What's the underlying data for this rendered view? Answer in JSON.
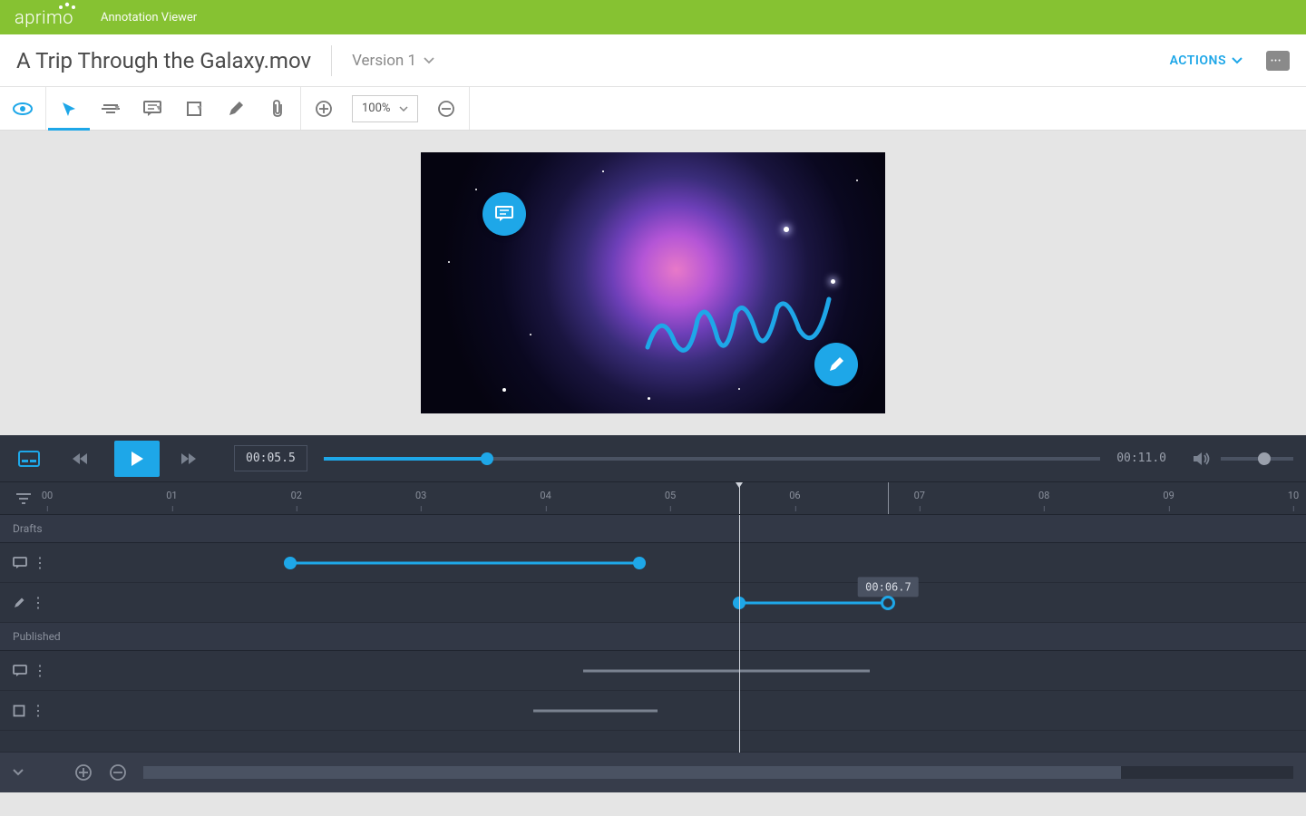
{
  "header": {
    "brand": "aprimo",
    "app_title": "Annotation Viewer"
  },
  "file": {
    "name": "A Trip Through the Galaxy.mov",
    "version_label": "Version 1",
    "actions_label": "ACTIONS"
  },
  "toolbar": {
    "zoom_level": "100%"
  },
  "player": {
    "current_time": "00:05.5",
    "duration": "00:11.0",
    "progress_pct": 21,
    "volume_pct": 60
  },
  "ruler": {
    "ticks": [
      "00",
      "01",
      "02",
      "03",
      "04",
      "05",
      "06",
      "07",
      "08",
      "09",
      "10"
    ],
    "playhead_pct": 55.5,
    "range_end_pct": 67.5
  },
  "sections": {
    "drafts": "Drafts",
    "published": "Published"
  },
  "tooltip_time": "00:06.7",
  "tracks": {
    "draft1": {
      "start_pct": 19.5,
      "end_pct": 47.5
    },
    "draft2": {
      "start_pct": 55.5,
      "end_pct": 67.5
    },
    "pub1": {
      "start_pct": 43,
      "end_pct": 66
    },
    "pub2": {
      "start_pct": 39,
      "end_pct": 49
    }
  },
  "hscroll": {
    "start_pct": 0,
    "width_pct": 85
  }
}
